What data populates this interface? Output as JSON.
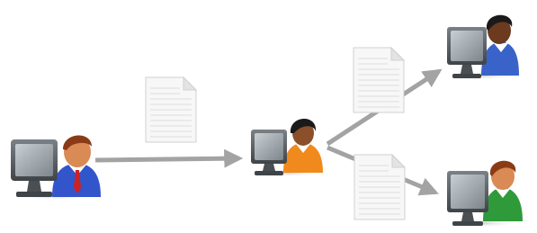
{
  "diagram": {
    "kind": "document-distribution-flow",
    "nodes": [
      {
        "id": "sender",
        "icon": "person-at-computer-icon",
        "shirt_color": "#3355cc",
        "tie_color": "#cc2222",
        "hair_color": "#8a3b16",
        "skin_color": "#d98a55"
      },
      {
        "id": "relay",
        "icon": "person-at-computer-icon",
        "shirt_color": "#f08a1c",
        "hair_color": "#1a1a1a",
        "skin_color": "#8b4f2a"
      },
      {
        "id": "recipient-top",
        "icon": "person-at-computer-icon",
        "shirt_color": "#3a63c9",
        "hair_color": "#1a1a1a",
        "skin_color": "#6b3a1f"
      },
      {
        "id": "recipient-bottom",
        "icon": "person-at-computer-icon",
        "shirt_color": "#2f9a3a",
        "hair_color": "#8a3b16",
        "skin_color": "#d98a55"
      }
    ],
    "edges": [
      {
        "from": "sender",
        "to": "relay",
        "payload": "document-icon"
      },
      {
        "from": "relay",
        "to": "recipient-top",
        "payload": "document-icon"
      },
      {
        "from": "relay",
        "to": "recipient-bottom",
        "payload": "document-icon"
      }
    ],
    "colors": {
      "arrow": "#a3a3a3",
      "paper": "#f7f7f7",
      "paper_lines": "#dcdcdc",
      "monitor": "#5e6469",
      "screen": "#9ea5ab"
    }
  }
}
